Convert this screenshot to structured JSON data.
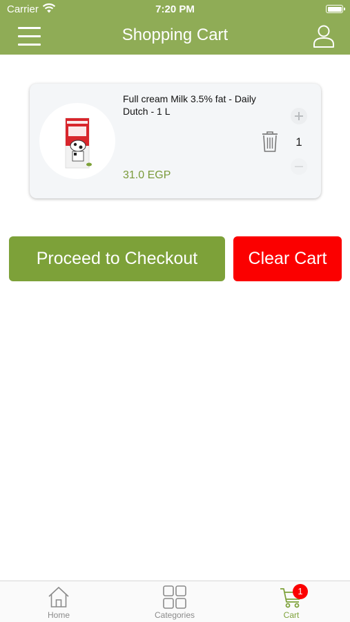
{
  "status_bar": {
    "carrier": "Carrier",
    "time": "7:20 PM"
  },
  "nav": {
    "title": "Shopping Cart"
  },
  "cart": {
    "items": [
      {
        "name": "Full cream Milk 3.5% fat - Daily Dutch - 1 L",
        "price": "31.0 EGP",
        "quantity": "1"
      }
    ]
  },
  "actions": {
    "checkout_label": "Proceed to Checkout",
    "clear_label": "Clear Cart"
  },
  "tabbar": {
    "tabs": [
      {
        "label": "Home",
        "icon": "home-icon"
      },
      {
        "label": "Categories",
        "icon": "grid-icon"
      },
      {
        "label": "Cart",
        "icon": "cart-icon",
        "badge": "1",
        "active": true
      }
    ]
  },
  "colors": {
    "brand_green": "#8fac56",
    "button_green": "#7da139",
    "danger_red": "#fb0000"
  }
}
